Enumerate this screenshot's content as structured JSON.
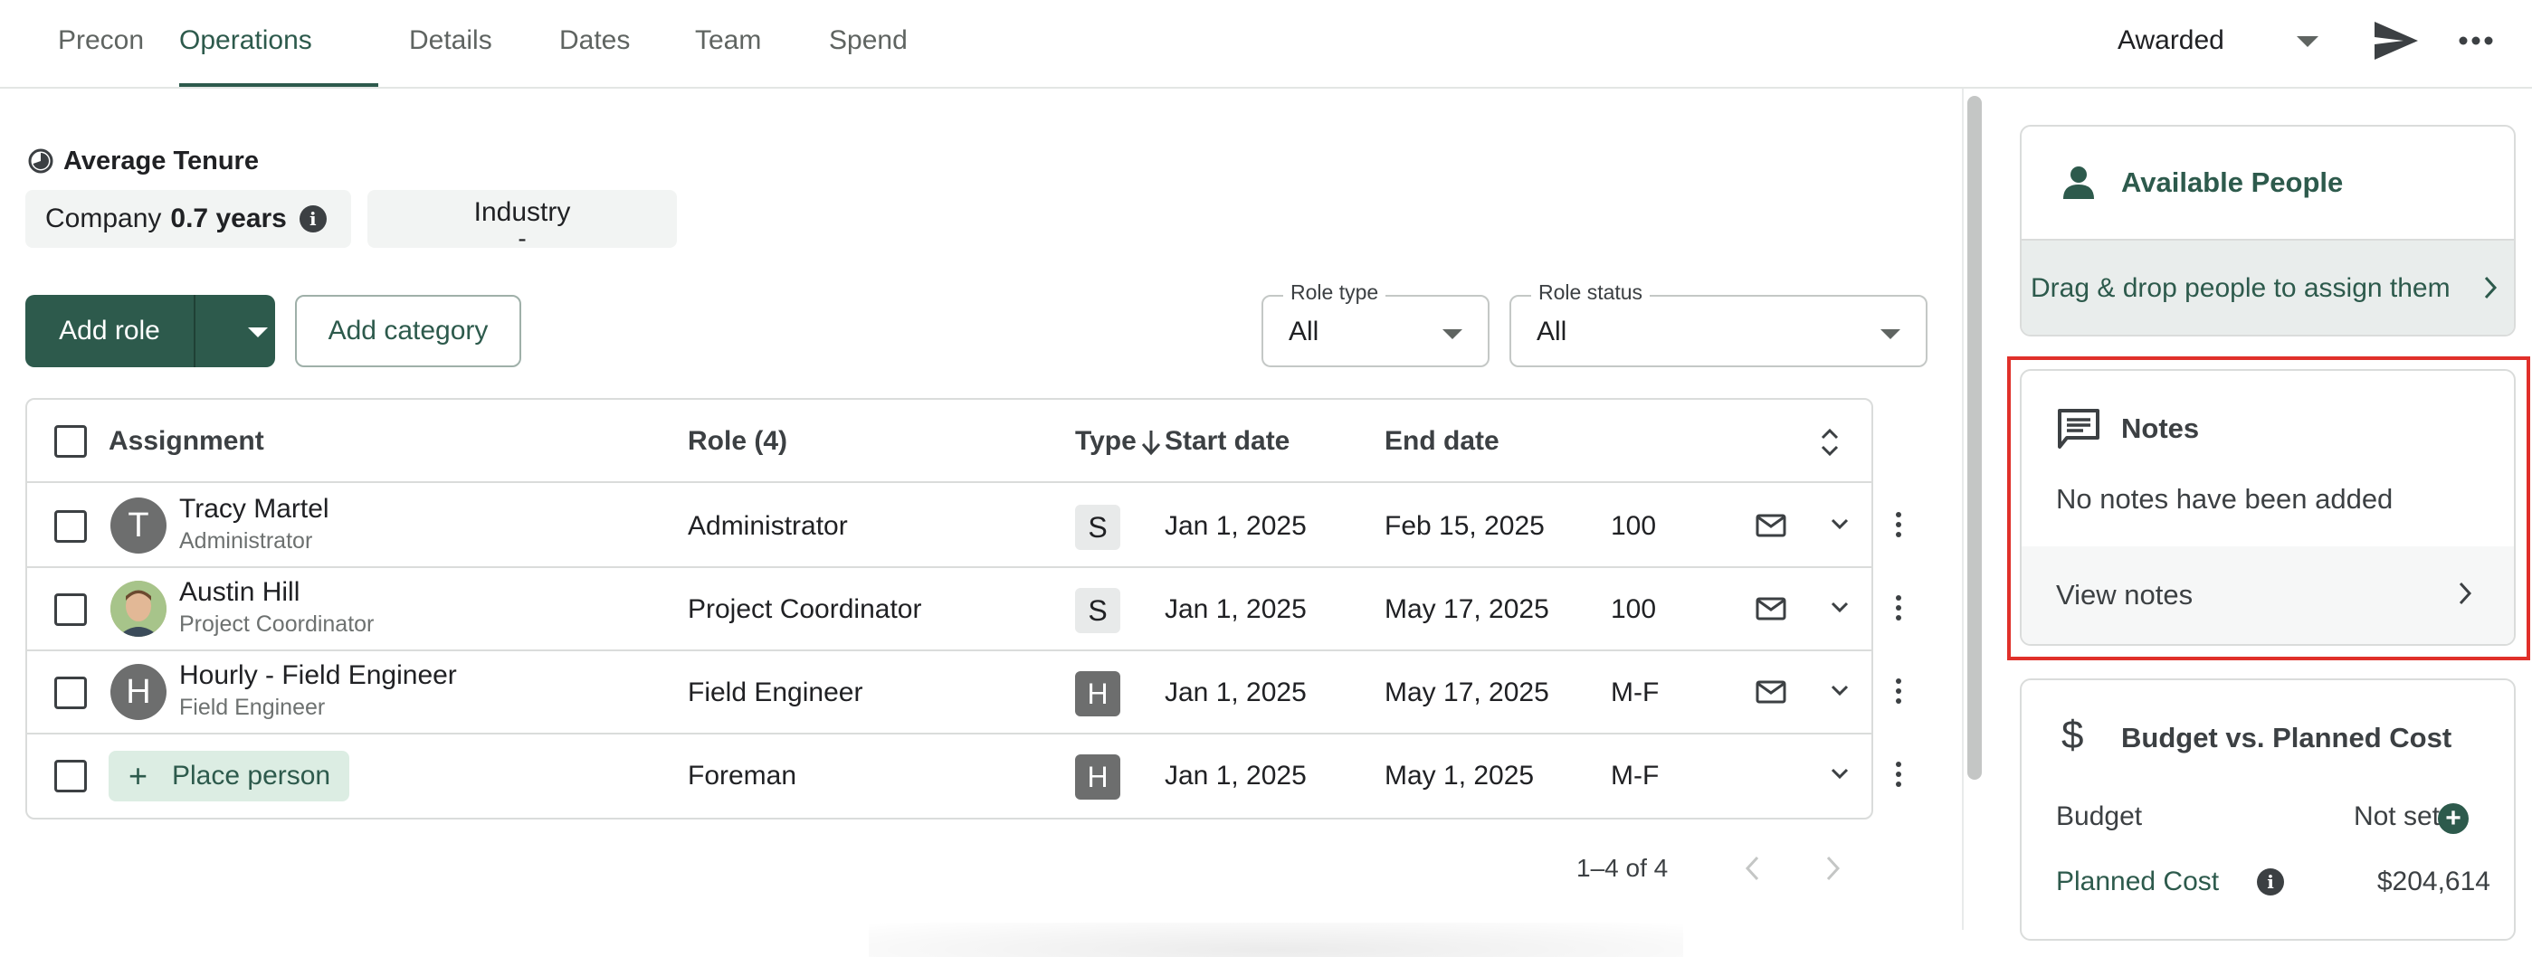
{
  "tabs": [
    {
      "label": "Precon"
    },
    {
      "label": "Operations"
    },
    {
      "label": "Details"
    },
    {
      "label": "Dates"
    },
    {
      "label": "Team"
    },
    {
      "label": "Spend"
    }
  ],
  "header": {
    "status": "Awarded"
  },
  "tenure": {
    "title": "Average Tenure",
    "company_label": "Company",
    "company_value": "0.7 years",
    "industry_label": "Industry",
    "industry_value": "-"
  },
  "toolbar": {
    "add_role": "Add role",
    "add_category": "Add category",
    "role_type_label": "Role type",
    "role_type_value": "All",
    "role_status_label": "Role status",
    "role_status_value": "All"
  },
  "table": {
    "headers": {
      "assignment": "Assignment",
      "role": "Role (4)",
      "type": "Type",
      "start": "Start date",
      "end": "End date"
    },
    "rows": [
      {
        "initial": "T",
        "name": "Tracy Martel",
        "subtitle": "Administrator",
        "role": "Administrator",
        "type": "S",
        "start": "Jan 1, 2025",
        "end": "Feb 15, 2025",
        "alloc": "100"
      },
      {
        "initial": "",
        "name": "Austin Hill",
        "subtitle": "Project Coordinator",
        "role": "Project Coordinator",
        "type": "S",
        "start": "Jan 1, 2025",
        "end": "May 17, 2025",
        "alloc": "100"
      },
      {
        "initial": "H",
        "name": "Hourly - Field Engineer",
        "subtitle": "Field Engineer",
        "role": "Field Engineer",
        "type": "H",
        "start": "Jan 1, 2025",
        "end": "May 17, 2025",
        "alloc": "M-F"
      },
      {
        "place_label": "Place person",
        "role": "Foreman",
        "type": "H",
        "start": "Jan 1, 2025",
        "end": "May 1, 2025",
        "alloc": "M-F"
      }
    ],
    "pagination": "1–4 of 4"
  },
  "panel": {
    "people_title": "Available People",
    "people_hint": "Drag & drop people to assign them",
    "notes_title": "Notes",
    "notes_empty": "No notes have been added",
    "notes_view": "View notes",
    "budget_title": "Budget vs. Planned Cost",
    "budget_label": "Budget",
    "budget_value": "Not set",
    "planned_label": "Planned Cost",
    "planned_value": "$204,614"
  },
  "colors": {
    "accent": "#2d5a4c",
    "highlight": "#e0302a"
  }
}
